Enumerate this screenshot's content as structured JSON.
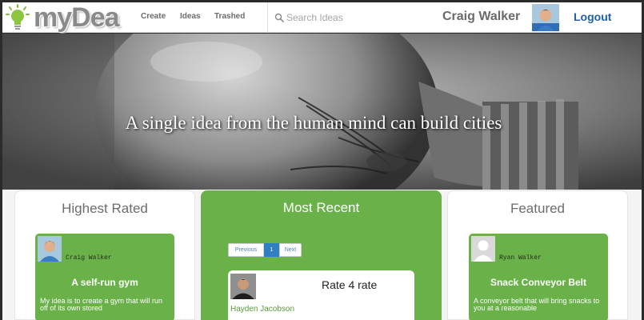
{
  "app": {
    "name": "myDea"
  },
  "nav": {
    "create": "Create",
    "ideas": "Ideas",
    "trashed": "Trashed"
  },
  "search": {
    "placeholder": "Search Ideas",
    "value": ""
  },
  "user": {
    "name": "Craig Walker",
    "logout": "Logout"
  },
  "hero": {
    "tagline": "A single idea from the human mind can build cities"
  },
  "panels": {
    "highest_rated": {
      "title": "Highest Rated",
      "card": {
        "author": "Craig Walker",
        "title": "A self-run gym",
        "description": "My idea is to create a gym that will run off of its own stored"
      }
    },
    "most_recent": {
      "title": "Most Recent",
      "pagination": {
        "previous": "Previous",
        "current": "1",
        "next": "Next"
      },
      "card": {
        "rate": "Rate 4 rate",
        "author": "Hayden Jacobson"
      }
    },
    "featured": {
      "title": "Featured",
      "card": {
        "author": "Ryan Walker",
        "title": "Snack Conveyor Belt",
        "description": "A conveyor belt that will bring snacks to you at a reasonable"
      }
    }
  },
  "colors": {
    "green": "#6ab14a",
    "link_blue": "#1f5fa8",
    "logo_gray": "#8a8a8a"
  },
  "icons": {
    "logo": "lightbulb-icon",
    "search": "search-icon"
  }
}
